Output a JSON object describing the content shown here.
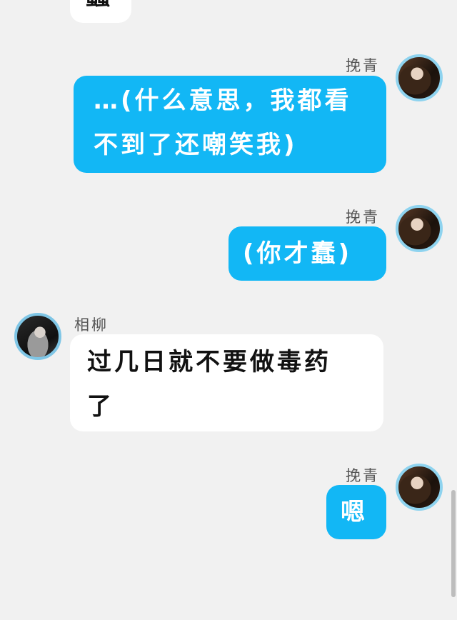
{
  "messages": [
    {
      "side": "left",
      "style": "white",
      "text": "蠢"
    },
    {
      "side": "right",
      "sender": "挽青",
      "style": "blue",
      "lines": [
        "…(什么意思，我都看",
        "不到了还嘲笑我)"
      ]
    },
    {
      "side": "right",
      "sender": "挽青",
      "style": "blue",
      "lines": [
        "(你才蠢)"
      ]
    },
    {
      "side": "left",
      "sender": "相柳",
      "style": "white",
      "lines": [
        "过几日就不要做毒药",
        "了"
      ]
    },
    {
      "side": "right",
      "sender": "挽青",
      "style": "blue",
      "lines": [
        "嗯"
      ]
    }
  ],
  "colors": {
    "blue_bubble": "#12b7f5",
    "white_bubble": "#ffffff",
    "background": "#f1f1f1"
  }
}
